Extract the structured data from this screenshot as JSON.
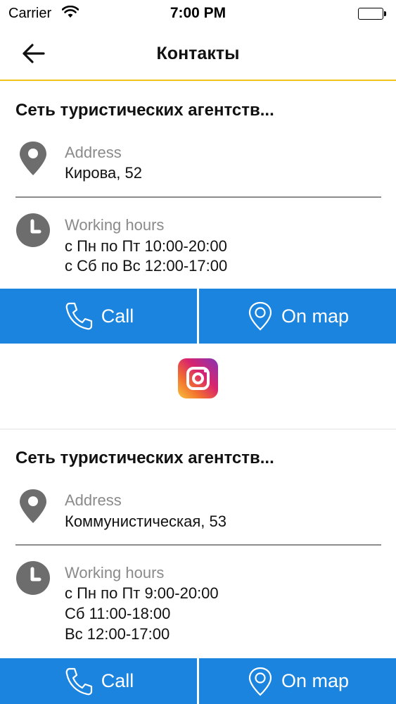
{
  "status_bar": {
    "carrier": "Carrier",
    "time": "7:00 PM"
  },
  "nav": {
    "title": "Контакты"
  },
  "contacts": [
    {
      "title": "Сеть туристических агентств...",
      "address_label": "Address",
      "address": "Кирова, 52",
      "hours_label": "Working hours",
      "hours": [
        "с Пн по Пт 10:00-20:00",
        "с Сб по Вс 12:00-17:00"
      ],
      "call_label": "Call",
      "map_label": "On map"
    },
    {
      "title": "Сеть туристических агентств...",
      "address_label": "Address",
      "address": "Коммунистическая, 53",
      "hours_label": "Working hours",
      "hours": [
        "с Пн по Пт 9:00-20:00",
        "Сб 11:00-18:00",
        "Вс 12:00-17:00"
      ],
      "call_label": "Call",
      "map_label": "On map"
    }
  ],
  "colors": {
    "accent_line": "#f0c419",
    "button_blue": "#1a84df",
    "icon_gray": "#6d6d6d"
  },
  "icons": [
    "wifi-icon",
    "battery-icon",
    "back-arrow-icon",
    "location-pin-icon",
    "clock-icon",
    "phone-icon",
    "map-pin-icon",
    "instagram-icon"
  ]
}
